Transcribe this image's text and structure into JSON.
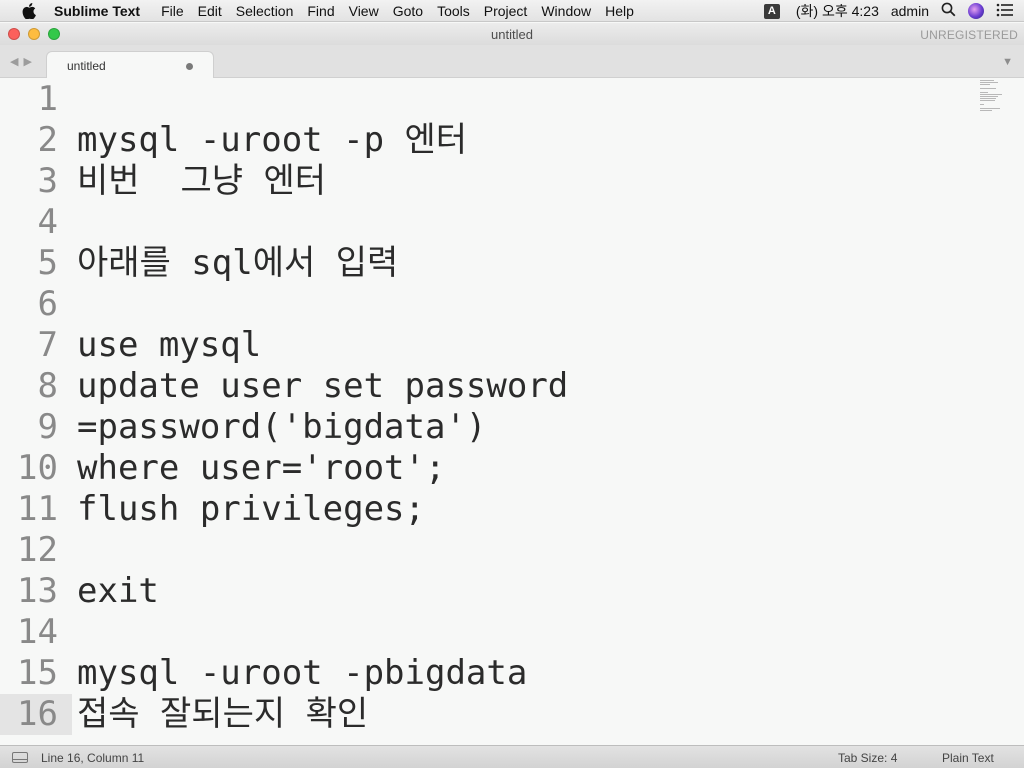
{
  "menubar": {
    "app_name": "Sublime Text",
    "items": [
      "File",
      "Edit",
      "Selection",
      "Find",
      "View",
      "Goto",
      "Tools",
      "Project",
      "Window",
      "Help"
    ],
    "input_source": "A",
    "clock": "(화) 오후 4:23",
    "user": "admin"
  },
  "window": {
    "title": "untitled",
    "license_status": "UNREGISTERED"
  },
  "tab": {
    "label": "untitled"
  },
  "editor": {
    "lines": [
      {
        "number": "1",
        "text": ""
      },
      {
        "number": "2",
        "text": "mysql -uroot -p 엔터"
      },
      {
        "number": "3",
        "text": "비번  그냥 엔터"
      },
      {
        "number": "4",
        "text": ""
      },
      {
        "number": "5",
        "text": "아래를 sql에서 입력"
      },
      {
        "number": "6",
        "text": ""
      },
      {
        "number": "7",
        "text": "use mysql"
      },
      {
        "number": "8",
        "text": "update user set password"
      },
      {
        "number": "9",
        "text": "=password('bigdata')"
      },
      {
        "number": "10",
        "text": "where user='root';"
      },
      {
        "number": "11",
        "text": "flush privileges;"
      },
      {
        "number": "12",
        "text": ""
      },
      {
        "number": "13",
        "text": "exit"
      },
      {
        "number": "14",
        "text": ""
      },
      {
        "number": "15",
        "text": "mysql -uroot -pbigdata"
      },
      {
        "number": "16",
        "text": "접속 잘되는지 확인"
      }
    ],
    "current_line": "16"
  },
  "statusbar": {
    "position": "Line 16, Column 11",
    "tab_size": "Tab Size: 4",
    "syntax": "Plain Text"
  }
}
